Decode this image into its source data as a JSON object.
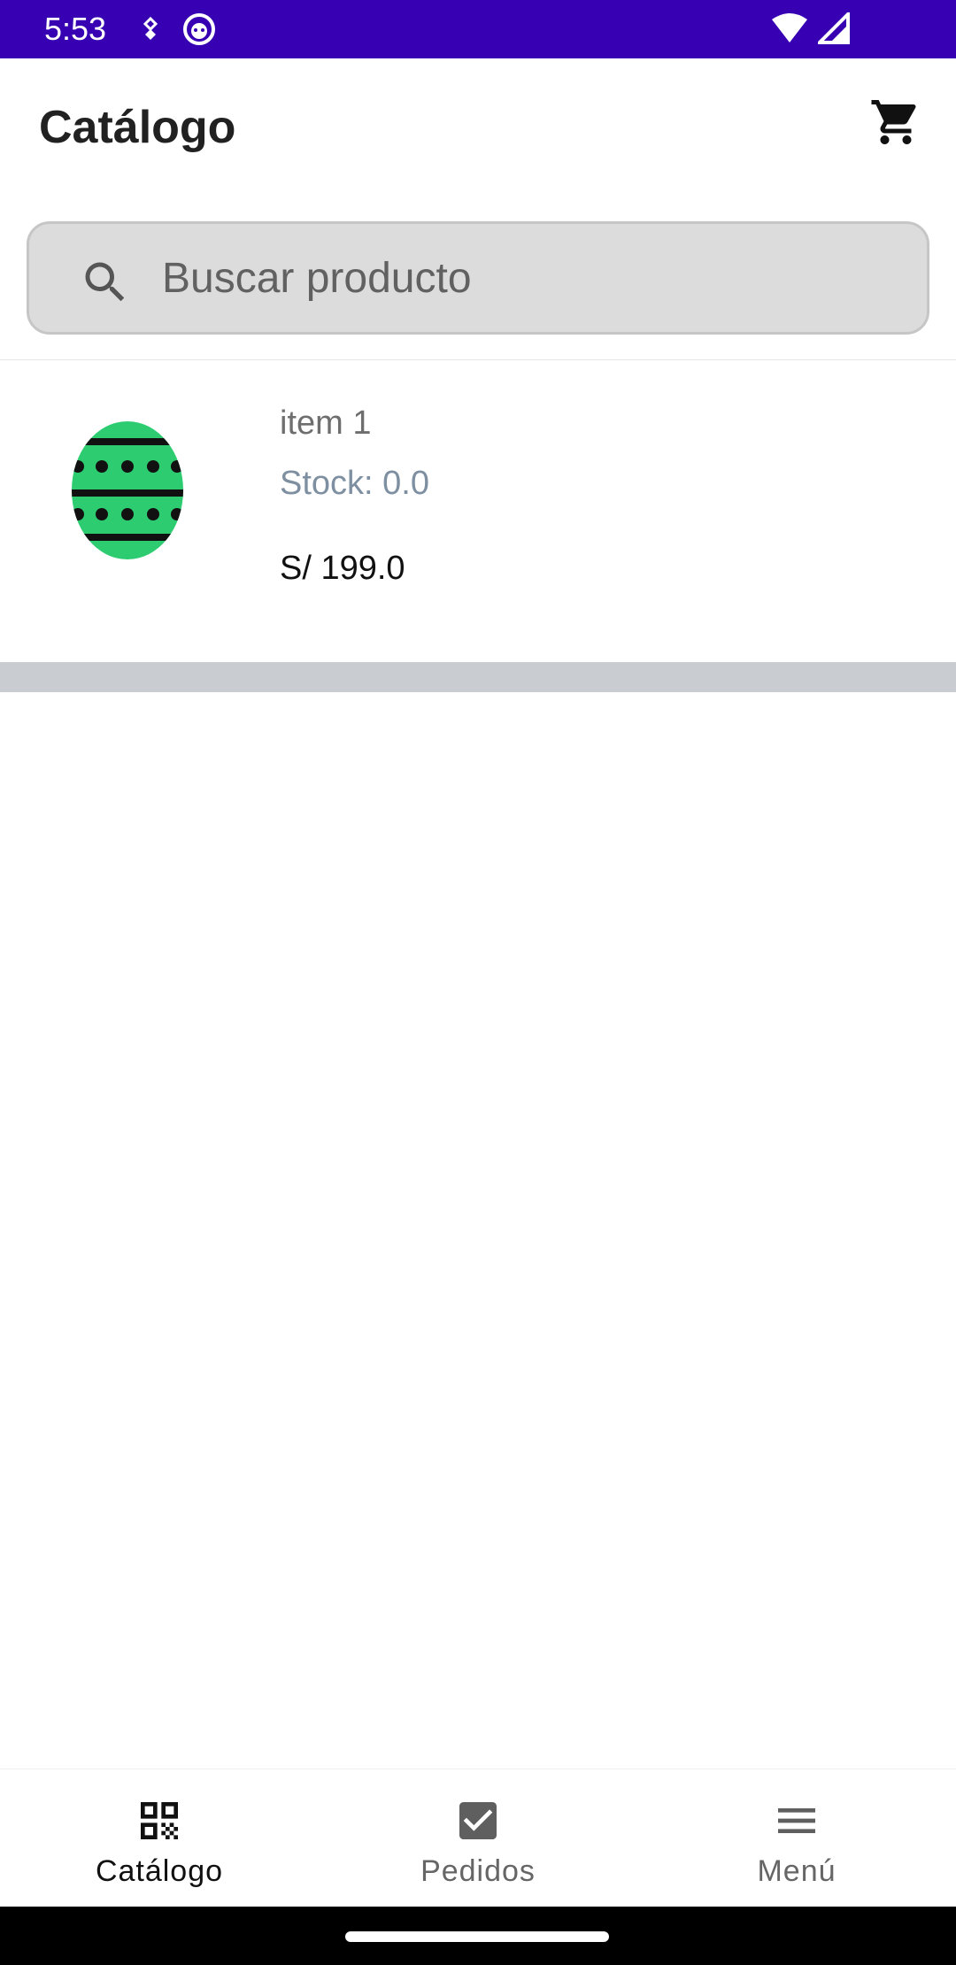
{
  "status_bar": {
    "time": "5:53",
    "background": "#3700b3"
  },
  "app_bar": {
    "title": "Catálogo",
    "cart_icon": "shopping-cart-icon"
  },
  "search": {
    "placeholder": "Buscar producto",
    "value": "",
    "icon": "search-icon"
  },
  "products": [
    {
      "name": "item 1",
      "stock": "Stock: 0.0",
      "price": "S/ 199.0",
      "image_colors": {
        "body": "#2ecc71",
        "stripes": "#111111"
      }
    }
  ],
  "bottom_nav": {
    "items": [
      {
        "label": "Catálogo",
        "icon": "qr-code-icon",
        "active": true
      },
      {
        "label": "Pedidos",
        "icon": "checkbox-icon",
        "active": false
      },
      {
        "label": "Menú",
        "icon": "menu-icon",
        "active": false
      }
    ]
  }
}
